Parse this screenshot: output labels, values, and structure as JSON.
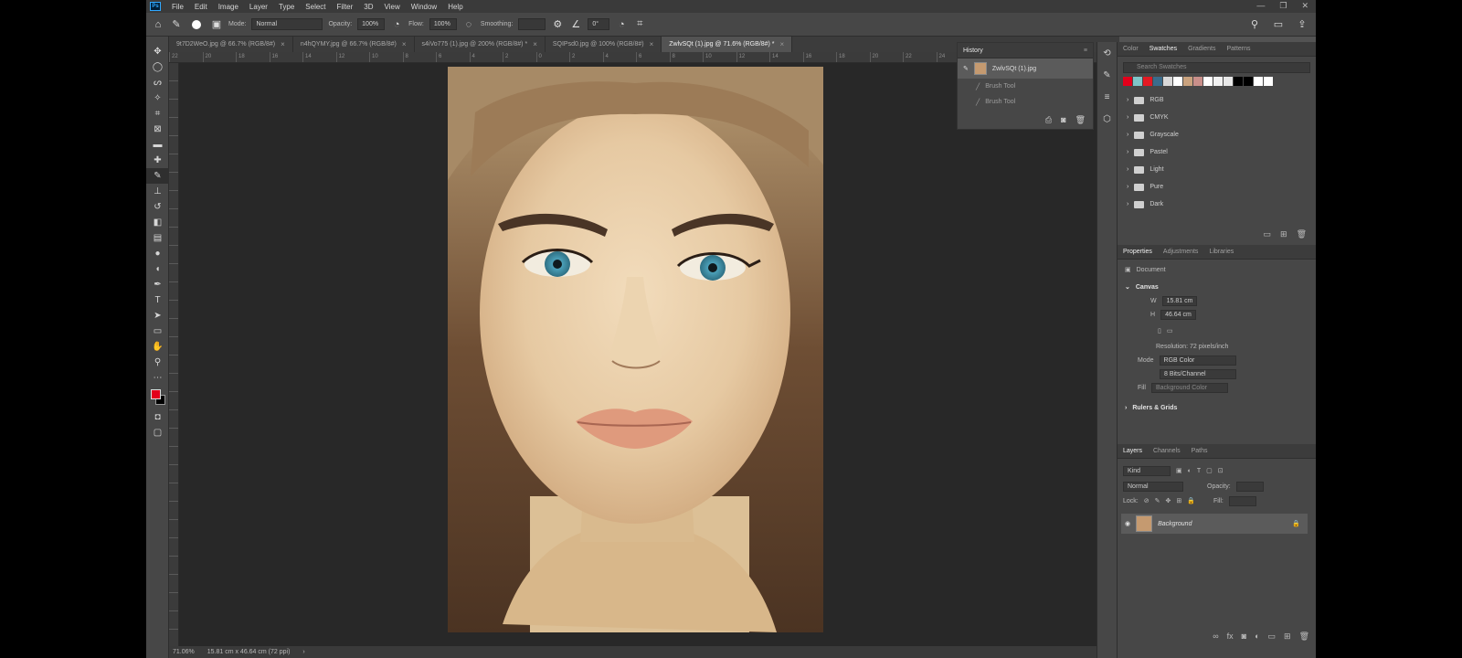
{
  "menu": [
    "File",
    "Edit",
    "Image",
    "Layer",
    "Type",
    "Select",
    "Filter",
    "3D",
    "View",
    "Window",
    "Help"
  ],
  "window_controls": [
    "—",
    "❐",
    "✕"
  ],
  "options": {
    "mode_label": "Mode:",
    "mode_value": "Normal",
    "opacity_label": "Opacity:",
    "opacity_value": "100%",
    "flow_label": "Flow:",
    "flow_value": "100%",
    "smoothing_label": "Smoothing:",
    "angle_value": "0°"
  },
  "tabs": [
    {
      "label": "9t7D2WeO.jpg @ 66.7% (RGB/8#)"
    },
    {
      "label": "n4hQYMY.jpg @ 66.7% (RGB/8#)"
    },
    {
      "label": "s4iVo775 (1).jpg @ 200% (RGB/8#) *"
    },
    {
      "label": "SQIPsd0.jpg @ 100% (RGB/8#)"
    },
    {
      "label": "ZwlvSQt (1).jpg @ 71.6% (RGB/8#) *"
    }
  ],
  "ruler_ticks": [
    "22",
    "20",
    "18",
    "16",
    "14",
    "12",
    "10",
    "8",
    "6",
    "4",
    "2",
    "0",
    "2",
    "4",
    "6",
    "8",
    "10",
    "12",
    "14",
    "16",
    "18",
    "20",
    "22",
    "24",
    "26",
    "28",
    "30",
    "32"
  ],
  "status": {
    "zoom": "71.06%",
    "doc_size": "15.81 cm x 46.64 cm (72 ppi)"
  },
  "history": {
    "title": "History",
    "snapshot": "ZwlvSQt (1).jpg",
    "steps": [
      "Brush Tool",
      "Brush Tool"
    ]
  },
  "swatches_panel": {
    "tabs": [
      "Color",
      "Swatches",
      "Gradients",
      "Patterns"
    ],
    "search_placeholder": "Search Swatches",
    "colors": [
      "#e3001b",
      "#7fc5c8",
      "#e21a23",
      "#3b6c8b",
      "#d9d9d9",
      "#ffffff",
      "#c9a27e",
      "#c98f8a",
      "#ffffff",
      "#f2f2f2",
      "#e8e8e8",
      "#000000",
      "#000000",
      "#ffffff",
      "#ffffff"
    ],
    "folders": [
      "RGB",
      "CMYK",
      "Grayscale",
      "Pastel",
      "Light",
      "Pure",
      "Dark"
    ]
  },
  "properties": {
    "tabs": [
      "Properties",
      "Adjustments",
      "Libraries"
    ],
    "doc_label": "Document",
    "canvas_head": "Canvas",
    "w_label": "W",
    "w_value": "15.81 cm",
    "h_label": "H",
    "h_value": "46.64 cm",
    "resolution": "Resolution: 72 pixels/inch",
    "mode_label": "Mode",
    "mode_value": "RGB Color",
    "depth_value": "8 Bits/Channel",
    "fill_label": "Fill",
    "fill_value": "Background Color",
    "rulers_head": "Rulers & Grids"
  },
  "layers": {
    "tabs": [
      "Layers",
      "Channels",
      "Paths"
    ],
    "filter_label": "Kind",
    "blend": "Normal",
    "opacity_label": "Opacity:",
    "lock_label": "Lock:",
    "fill_label": "Fill:",
    "layer_name": "Background"
  }
}
